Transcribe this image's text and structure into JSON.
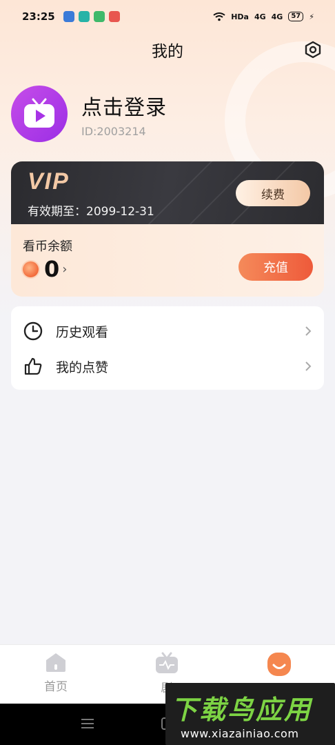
{
  "status_bar": {
    "time": "23:25",
    "network": "HDa",
    "signal1": "4G",
    "signal2": "4G",
    "battery": "57",
    "app_colors": [
      "#3b7bd8",
      "#27b3a7",
      "#3fb96a",
      "#e8564f"
    ]
  },
  "header": {
    "title": "我的"
  },
  "profile": {
    "login_text": "点击登录",
    "user_id": "ID:2003214"
  },
  "vip": {
    "logo": "VIP",
    "expiry": "有效期至：2099-12-31",
    "renew_label": "续费",
    "coin_label": "看币余额",
    "coin_value": "0",
    "recharge_label": "充值"
  },
  "menu": {
    "items": [
      {
        "label": "历史观看",
        "icon": "clock-icon"
      },
      {
        "label": "我的点赞",
        "icon": "thumbs-up-icon"
      }
    ]
  },
  "bottom_nav": {
    "items": [
      {
        "label": "首页",
        "icon": "home-icon",
        "active": false
      },
      {
        "label": "剧",
        "icon": "tv-icon",
        "active": false
      },
      {
        "label": "",
        "icon": "profile-face-icon",
        "active": true
      }
    ]
  },
  "watermark": {
    "title": "下载鸟应用",
    "url": "www.xiazainiao.com"
  },
  "colors": {
    "accent": "#f07a4a",
    "avatar": "#b23fe6",
    "vip_gold": "#f3c9a6"
  }
}
